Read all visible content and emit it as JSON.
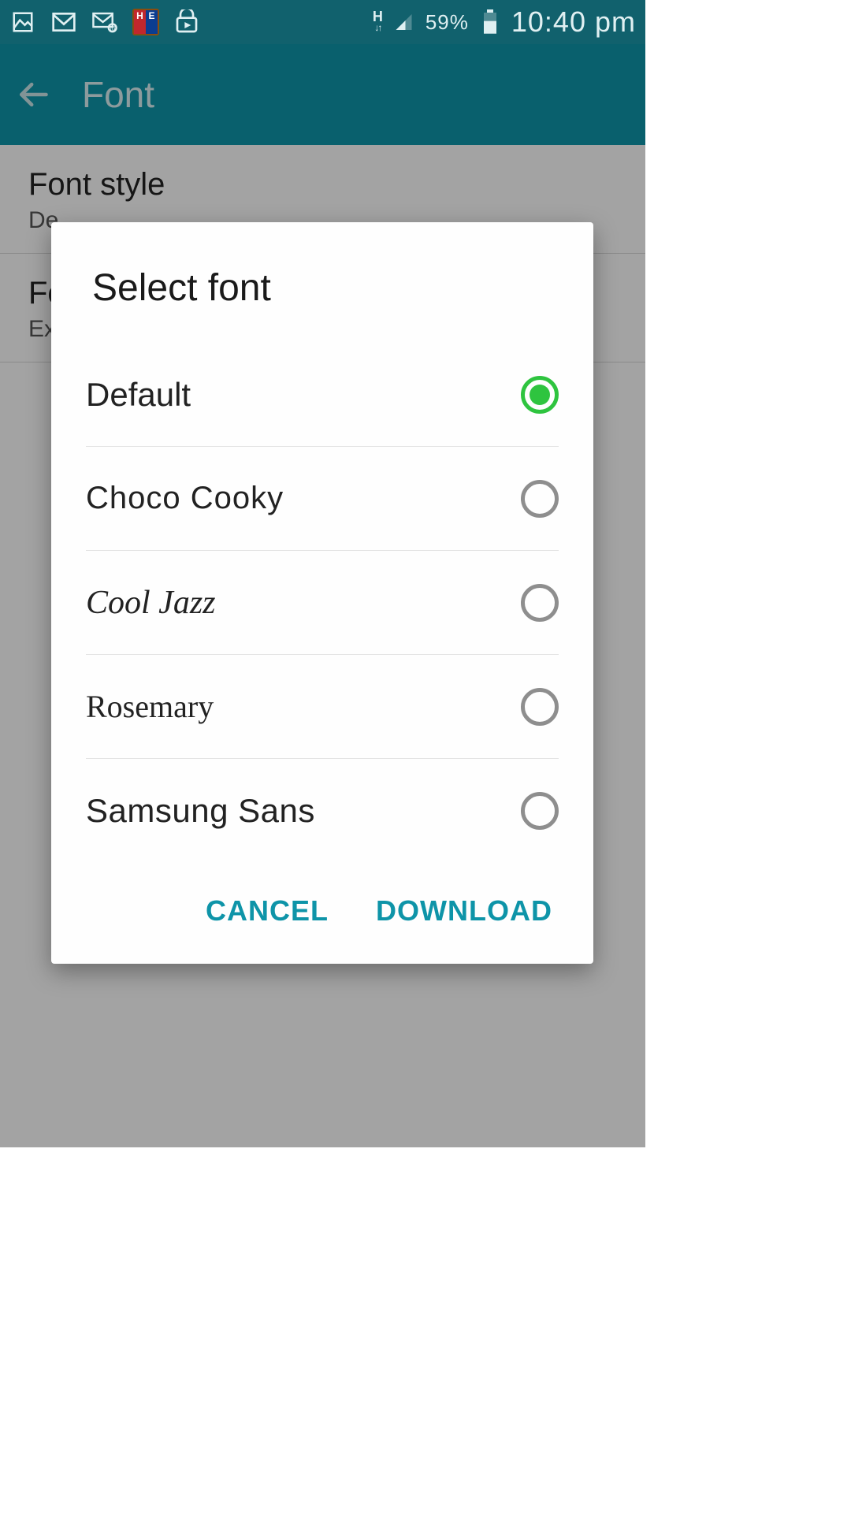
{
  "status": {
    "battery_pct": "59%",
    "time": "10:40 pm",
    "network_indicator": "H"
  },
  "appbar": {
    "title": "Font"
  },
  "background": {
    "row1_title": "Font style",
    "row1_sub": "De",
    "row2_title": "Fo",
    "row2_sub": "Ex"
  },
  "dialog": {
    "title": "Select font",
    "options": [
      {
        "label": "Default",
        "selected": true,
        "style": "font-default"
      },
      {
        "label": "Choco Cooky",
        "selected": false,
        "style": "font-choco"
      },
      {
        "label": "Cool Jazz",
        "selected": false,
        "style": "font-cooljazz"
      },
      {
        "label": "Rosemary",
        "selected": false,
        "style": "font-rosemary"
      },
      {
        "label": "Samsung Sans",
        "selected": false,
        "style": "font-samsung"
      }
    ],
    "cancel": "CANCEL",
    "download": "DOWNLOAD"
  }
}
